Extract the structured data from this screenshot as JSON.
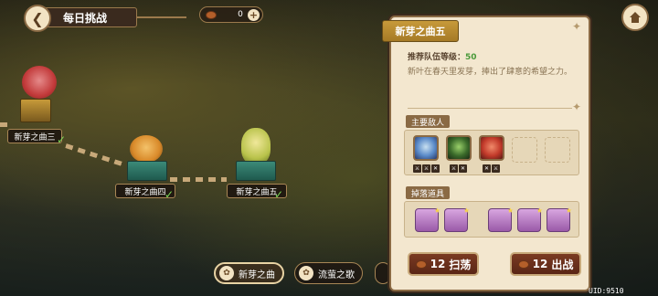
{
  "header": {
    "title": "每日挑战",
    "currency_value": "0"
  },
  "stages": [
    {
      "label": "新芽之曲三",
      "cleared": true
    },
    {
      "label": "新芽之曲四",
      "cleared": true
    },
    {
      "label": "新芽之曲五",
      "cleared": true
    }
  ],
  "tabs": [
    {
      "label": "新芽之曲",
      "active": true
    },
    {
      "label": "流萤之歌",
      "active": false
    }
  ],
  "uid": "UID:9510",
  "panel": {
    "title": "新芽之曲五",
    "recommend_label": "推荐队伍等级：",
    "recommend_value": "50",
    "description": "新叶在春天里发芽，捧出了肆意的希望之力。",
    "enemies_label": "主要敌人",
    "drops_label": "掉落道具",
    "sweep_cost": "12",
    "sweep_label": "扫荡",
    "battle_cost": "12",
    "battle_label": "出战"
  },
  "colors": {
    "accent": "#c79a3a",
    "panel_bg": "#f3e7cf",
    "button": "#6a2e1c",
    "ok": "#7ed957"
  }
}
